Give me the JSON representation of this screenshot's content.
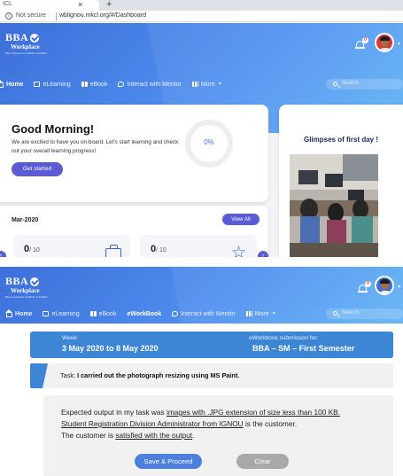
{
  "browser": {
    "tab_title": "ICL",
    "tab_close": "×",
    "new_tab": "+",
    "insecure_label": "Not secure",
    "url": "wblignou.mkcl.org/#/Dashboard",
    "info_icon": "info-icon"
  },
  "brand": {
    "logo_main": "BBA",
    "logo_sub": "Workplace",
    "logo_tagline": "Best experience at MKCL & IGNOU"
  },
  "header": {
    "notification_count": "0",
    "avatar_caret": "▾"
  },
  "nav1": {
    "items": [
      {
        "label": "Home",
        "icon": "home-icon"
      },
      {
        "label": "eLearning",
        "icon": "screen-icon"
      },
      {
        "label": "eBook",
        "icon": "book-icon"
      },
      {
        "label": "Interact with Mentor",
        "icon": "chat-icon"
      },
      {
        "label": "More",
        "icon": "grid-icon"
      }
    ],
    "search_placeholder": "Search"
  },
  "greeting": {
    "title": "Good Morning!",
    "message": "We are excited to have you on-board. Let's start learning and check out your overall learning progress!",
    "button": "Get started",
    "progress": "0%",
    "progress_value": 0
  },
  "glimpse": {
    "title": "Glimpses of first day !"
  },
  "summary": {
    "month": "Mar-2020",
    "view_all": "View All",
    "stats": [
      {
        "value": "0",
        "total": "/ 10",
        "icon": "bag-icon"
      },
      {
        "value": "0",
        "total": "/ 10",
        "icon": "star-icon"
      }
    ],
    "left_arrow": "‹",
    "right_arrow": "›"
  },
  "nav2": {
    "items": [
      {
        "label": "Home",
        "icon": "home-icon"
      },
      {
        "label": "eLearning",
        "icon": "screen-icon"
      },
      {
        "label": "eBook",
        "icon": "book-icon"
      },
      {
        "label": "eWorkBook",
        "icon": ""
      },
      {
        "label": "Interact with Mentor",
        "icon": "chat-icon"
      },
      {
        "label": "More",
        "icon": "grid-icon"
      }
    ],
    "search_placeholder": "Search"
  },
  "workbook": {
    "week_label": "Week:",
    "week_value": "3 May 2020 to 8 May 2020",
    "submission_label": "eWorkbook submission for:",
    "submission_value": "BBA – SM – First Semester",
    "task_prefix": "Task: ",
    "task_text": "I carried out the photograph resizing using MS Paint.",
    "output_part1": "Expected output in my task was ",
    "output_u1": "images with .JPG extension of size less than 100 KB.",
    "output_u2": "Student Registration Division Administrator from IGNOU",
    "output_part2": " is the customer.",
    "output_part3": "The customer is ",
    "output_u3": "satisfied with the output",
    "output_part4": ".",
    "save_button": "Save & Proceed",
    "clear_button": "Clear"
  },
  "colors": {
    "brand_blue": "#4f8ff0",
    "button_purple": "#5b5bd6",
    "workbook_blue": "#3d86d6",
    "clear_gray": "#a9a9a9"
  }
}
